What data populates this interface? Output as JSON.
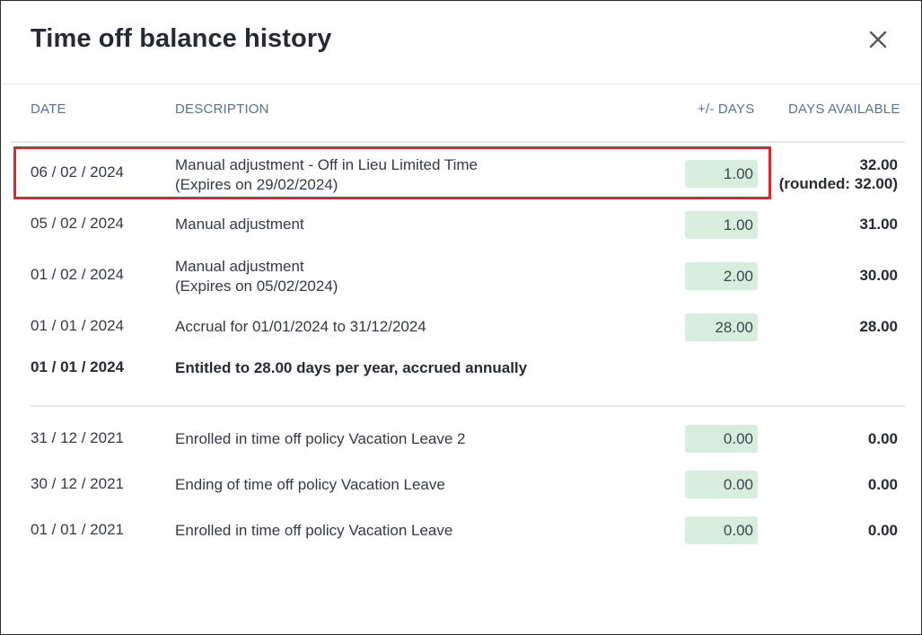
{
  "dialog": {
    "title": "Time off balance history",
    "close_label": "×"
  },
  "columns": {
    "date": "DATE",
    "description": "DESCRIPTION",
    "days_change": "+/- DAYS",
    "days_available": "DAYS AVAILABLE"
  },
  "rows": [
    {
      "date": "06 / 02 / 2024",
      "desc_line1": "Manual adjustment - Off in Lieu Limited Time",
      "desc_line2": "(Expires on 29/02/2024)",
      "days": "1.00",
      "avail_line1": "32.00",
      "avail_line2": "(rounded: 32.00)"
    },
    {
      "date": "05 / 02 / 2024",
      "desc_line1": "Manual adjustment",
      "days": "1.00",
      "avail_line1": "31.00"
    },
    {
      "date": "01 / 02 / 2024",
      "desc_line1": "Manual adjustment",
      "desc_line2": "(Expires on 05/02/2024)",
      "days": "2.00",
      "avail_line1": "30.00"
    },
    {
      "date": "01 / 01 / 2024",
      "desc_line1": "Accrual for 01/01/2024 to 31/12/2024",
      "days": "28.00",
      "avail_line1": "28.00"
    },
    {
      "date": "01 / 01 / 2024",
      "desc_line1": "Entitled to 28.00 days per year, accrued annually"
    },
    {
      "date": "31 / 12 / 2021",
      "desc_line1": "Enrolled in time off policy Vacation Leave 2",
      "days": "0.00",
      "avail_line1": "0.00"
    },
    {
      "date": "30 / 12 / 2021",
      "desc_line1": "Ending of time off policy Vacation Leave",
      "days": "0.00",
      "avail_line1": "0.00"
    },
    {
      "date": "01 / 01 / 2021",
      "desc_line1": "Enrolled in time off policy Vacation Leave",
      "days": "0.00",
      "avail_line1": "0.00"
    }
  ],
  "colors": {
    "pill_bg": "#d7eedf",
    "highlight": "#e0242c",
    "header_text": "#5a7290"
  }
}
